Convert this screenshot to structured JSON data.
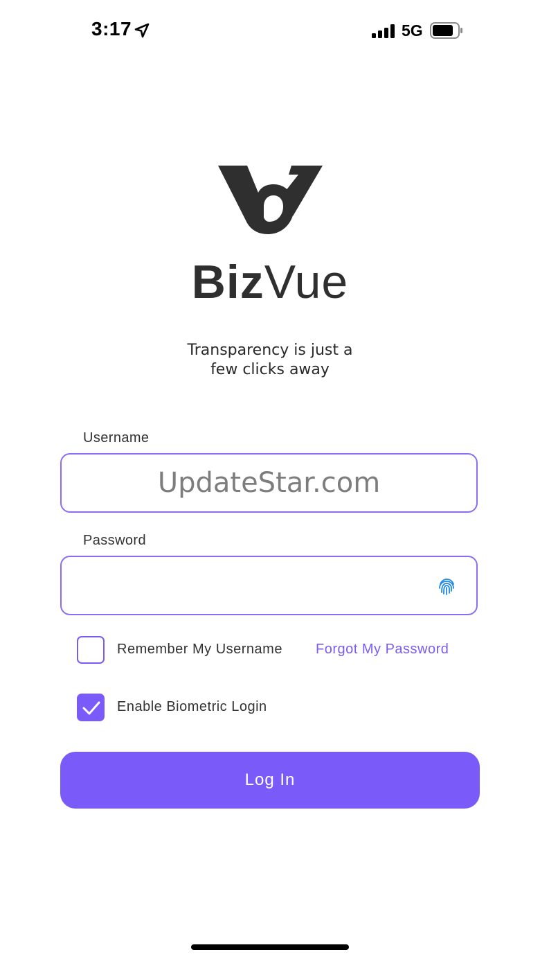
{
  "status_bar": {
    "time": "3:17",
    "network": "5G",
    "icons": [
      "location-arrow-icon",
      "signal-bars-icon",
      "battery-icon"
    ]
  },
  "brand": {
    "name_bold": "Biz",
    "name_light": "Vue",
    "logo_icon": "bizvue-logo-icon",
    "text_color": "#2f2f2f"
  },
  "tagline": {
    "line1": "Transparency is just a",
    "line2": "few clicks away"
  },
  "form": {
    "username": {
      "label": "Username",
      "value": "UpdateStar.com",
      "placeholder": ""
    },
    "password": {
      "label": "Password",
      "value": "",
      "placeholder": "",
      "icon": "fingerprint-icon"
    },
    "remember": {
      "label": "Remember My Username",
      "checked": false
    },
    "forgot_link": "Forgot My Password",
    "biometric": {
      "label": "Enable Biometric Login",
      "checked": true
    },
    "login_button": "Log In"
  },
  "colors": {
    "accent": "#7a5af8",
    "input_border": "#8a6df5",
    "fingerprint": "#1e88e5",
    "background": "#ffffff"
  }
}
